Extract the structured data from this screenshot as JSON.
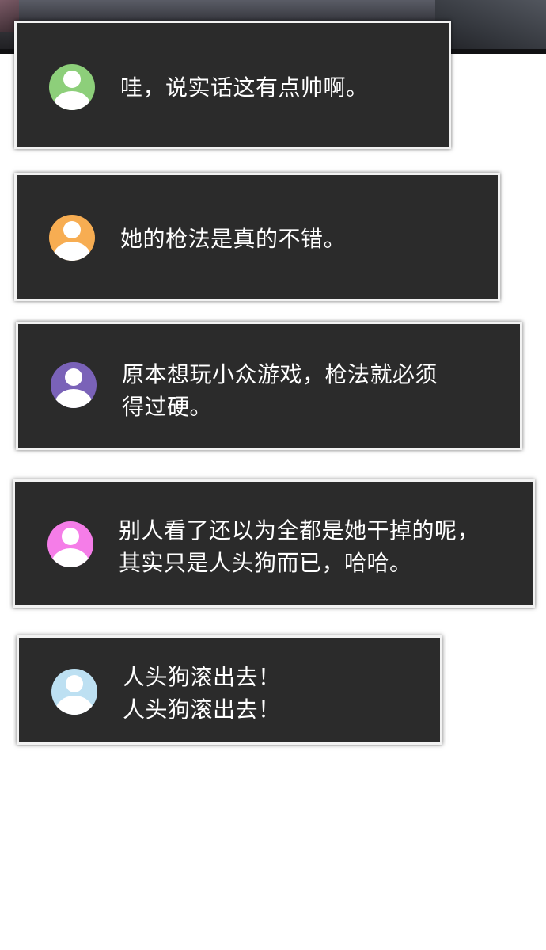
{
  "comments": [
    {
      "text_lines": [
        "哇，说实话这有点帅啊。"
      ],
      "avatar_color": "#8dcf7a"
    },
    {
      "text_lines": [
        "她的枪法是真的不错。"
      ],
      "avatar_color": "#f7ad52"
    },
    {
      "text_lines": [
        "原本想玩小众游戏，枪法就必须",
        "得过硬。"
      ],
      "avatar_color": "#7a62b8"
    },
    {
      "text_lines": [
        "别人看了还以为全都是她干掉的呢，",
        "其实只是人头狗而已，哈哈。"
      ],
      "avatar_color": "#f57de8"
    },
    {
      "text_lines": [
        "人头狗滚出去！",
        "人头狗滚出去！"
      ],
      "avatar_color": "#bde0f2"
    }
  ],
  "colors": {
    "box_background": "#2b2b2b",
    "box_border": "#f2f2f2",
    "text": "#ffffff",
    "page_background": "#ffffff"
  }
}
